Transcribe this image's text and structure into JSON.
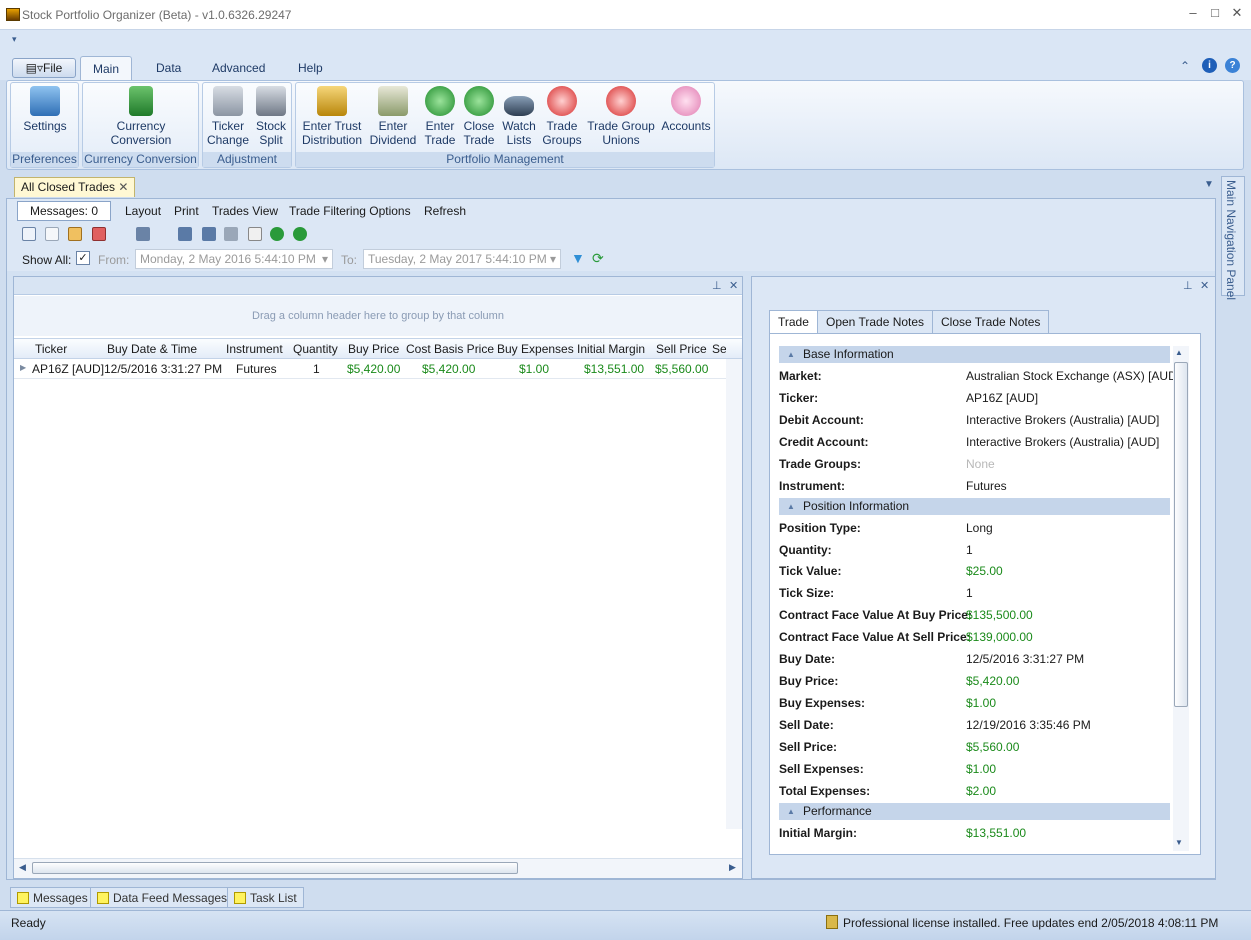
{
  "window": {
    "title": "Stock Portfolio Organizer (Beta) - v1.0.6326.29247"
  },
  "ribbon": {
    "file_label": "File",
    "tabs": [
      "Main",
      "Data",
      "Advanced",
      "Help"
    ],
    "groups": [
      {
        "label": "Preferences",
        "buttons": [
          {
            "label": "Settings",
            "icon": "settings-icon"
          }
        ]
      },
      {
        "label": "Currency Conversion",
        "buttons": [
          {
            "label": "Currency Conversion",
            "icon": "currency-icon"
          }
        ]
      },
      {
        "label": "Adjustment",
        "buttons": [
          {
            "label": "Ticker Change",
            "icon": "ticker-change-icon"
          },
          {
            "label": "Stock Split",
            "icon": "stock-split-icon"
          }
        ]
      },
      {
        "label": "Portfolio Management",
        "buttons": [
          {
            "label": "Enter Trust Distribution",
            "icon": "trust-icon"
          },
          {
            "label": "Enter Dividend",
            "icon": "dividend-icon"
          },
          {
            "label": "Enter Trade",
            "icon": "enter-trade-icon"
          },
          {
            "label": "Close Trade",
            "icon": "close-trade-icon"
          },
          {
            "label": "Watch Lists",
            "icon": "binoculars-icon"
          },
          {
            "label": "Trade Groups",
            "icon": "trade-groups-icon"
          },
          {
            "label": "Trade Group Unions",
            "icon": "trade-group-unions-icon"
          },
          {
            "label": "Accounts",
            "icon": "piggy-bank-icon"
          }
        ]
      }
    ]
  },
  "doc_tab": {
    "label": "All Closed Trades"
  },
  "menu": {
    "messages_label": "Messages: 0",
    "items": [
      "Layout",
      "Print",
      "Trades View",
      "Trade Filtering Options",
      "Refresh"
    ]
  },
  "filter": {
    "show_all_label": "Show All:",
    "show_all_checked": true,
    "from_label": "From:",
    "from_value": "Monday, 2 May 2016 5:44:10 PM",
    "to_label": "To:",
    "to_value": "Tuesday, 2 May 2017 5:44:10 PM"
  },
  "grid": {
    "group_hint": "Drag a column header here to group by that column",
    "columns": [
      "Ticker",
      "Buy Date & Time",
      "Instrument",
      "Quantity",
      "Buy Price",
      "Cost Basis Price",
      "Buy Expenses",
      "Initial Margin",
      "Sell Price",
      "Se"
    ],
    "rows": [
      [
        "AP16Z [AUD]",
        "12/5/2016 3:31:27 PM",
        "Futures",
        "1",
        "$5,420.00",
        "$5,420.00",
        "$1.00",
        "$13,551.00",
        "$5,560.00",
        ""
      ]
    ]
  },
  "detail": {
    "tabs": [
      "Trade",
      "Open Trade Notes",
      "Close Trade Notes"
    ],
    "sections": [
      {
        "title": "Base Information",
        "fields": [
          {
            "label": "Market:",
            "value": "Australian Stock Exchange (ASX) [AUD]"
          },
          {
            "label": "Ticker:",
            "value": "AP16Z [AUD]"
          },
          {
            "label": "Debit Account:",
            "value": "Interactive Brokers (Australia) [AUD]"
          },
          {
            "label": "Credit Account:",
            "value": "Interactive Brokers (Australia) [AUD]"
          },
          {
            "label": "Trade Groups:",
            "value": "None"
          },
          {
            "label": "Instrument:",
            "value": "Futures"
          }
        ]
      },
      {
        "title": "Position Information",
        "fields": [
          {
            "label": "Position Type:",
            "value": "Long"
          },
          {
            "label": "Quantity:",
            "value": "1"
          },
          {
            "label": "Tick Value:",
            "value": "$25.00"
          },
          {
            "label": "Tick Size:",
            "value": "1"
          },
          {
            "label": "Contract Face Value At Buy Price:",
            "value": "$135,500.00"
          },
          {
            "label": "Contract Face Value At Sell Price:",
            "value": "$139,000.00"
          },
          {
            "label": "Buy Date:",
            "value": "12/5/2016 3:31:27 PM"
          },
          {
            "label": "Buy Price:",
            "value": "$5,420.00"
          },
          {
            "label": "Buy Expenses:",
            "value": "$1.00"
          },
          {
            "label": "Sell Date:",
            "value": "12/19/2016 3:35:46 PM"
          },
          {
            "label": "Sell Price:",
            "value": "$5,560.00"
          },
          {
            "label": "Sell Expenses:",
            "value": "$1.00"
          },
          {
            "label": "Total Expenses:",
            "value": "$2.00"
          }
        ]
      },
      {
        "title": "Performance",
        "fields": [
          {
            "label": "Initial Margin:",
            "value": "$13,551.00"
          }
        ]
      }
    ]
  },
  "nav_panel": {
    "label": "Main Navigation Panel"
  },
  "bottom_tabs": [
    "Messages",
    "Data Feed Messages",
    "Task List"
  ],
  "status": {
    "left": "Ready",
    "right": "Professional license installed. Free updates end 2/05/2018 4:08:11 PM"
  },
  "colors": {
    "accent": "#cfddef",
    "positive": "#1a8a1a"
  }
}
